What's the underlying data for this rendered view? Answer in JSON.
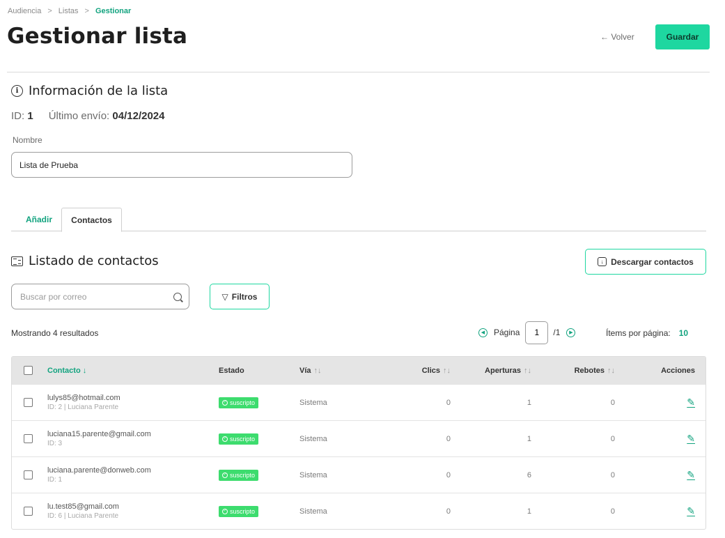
{
  "breadcrumb": {
    "items": [
      "Audiencia",
      "Listas"
    ],
    "current": "Gestionar",
    "separator": ">"
  },
  "header": {
    "title": "Gestionar lista",
    "back_label": "← Volver",
    "save_label": "Guardar"
  },
  "info": {
    "title": "Información de la lista",
    "id_label": "ID:",
    "id_value": "1",
    "last_send_label": "Último envío:",
    "last_send_value": "04/12/2024",
    "name_label": "Nombre",
    "name_value": "Lista de Prueba"
  },
  "tabs": [
    {
      "label": "Añadir",
      "active": false
    },
    {
      "label": "Contactos",
      "active": true
    }
  ],
  "contacts": {
    "title": "Listado de contactos",
    "download_label": "Descargar contactos",
    "search_placeholder": "Buscar por correo",
    "filter_label": "Filtros",
    "results_text": "Mostrando 4 resultados",
    "pager": {
      "page_label": "Página",
      "page_value": "1",
      "total": "/1",
      "per_page_label": "Ítems por página:",
      "per_page_value": "10"
    },
    "columns": {
      "contact": "Contacto ↓",
      "state": "Estado",
      "via": "Vía",
      "clics": "Clics",
      "aperturas": "Aperturas",
      "rebotes": "Rebotes",
      "acciones": "Acciones",
      "sort_glyph": "↑↓"
    },
    "rows": [
      {
        "email": "lulys85@hotmail.com",
        "sub": "ID: 2 | Luciana Parente",
        "state": "suscripto",
        "via": "Sistema",
        "clics": "0",
        "aperturas": "1",
        "rebotes": "0"
      },
      {
        "email": "luciana15.parente@gmail.com",
        "sub": "ID: 3",
        "state": "suscripto",
        "via": "Sistema",
        "clics": "0",
        "aperturas": "1",
        "rebotes": "0"
      },
      {
        "email": "luciana.parente@donweb.com",
        "sub": "ID: 1",
        "state": "suscripto",
        "via": "Sistema",
        "clics": "0",
        "aperturas": "6",
        "rebotes": "0"
      },
      {
        "email": "lu.test85@gmail.com",
        "sub": "ID: 6 | Luciana Parente",
        "state": "suscripto",
        "via": "Sistema",
        "clics": "0",
        "aperturas": "1",
        "rebotes": "0"
      }
    ]
  },
  "colors": {
    "accent": "#1ed7a0",
    "accent_text": "#12a37f",
    "badge": "#3ddc6e"
  }
}
